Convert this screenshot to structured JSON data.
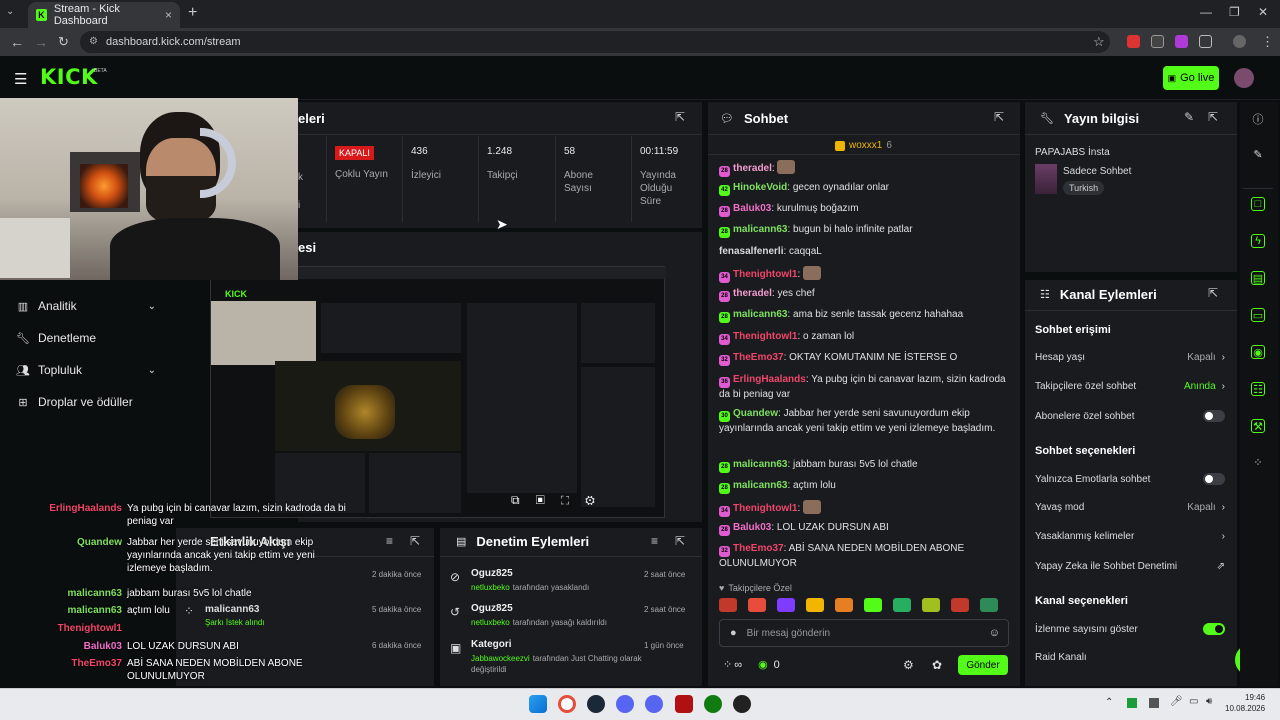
{
  "browser": {
    "tab_title": "Stream - Kick Dashboard",
    "url": "dashboard.kick.com/stream"
  },
  "kick": {
    "logo": "KICK",
    "beta": "BETA",
    "go_live": "Go live"
  },
  "sidebar": {
    "items": [
      {
        "label": "Analitik",
        "icon": "chart-icon"
      },
      {
        "label": "Denetleme",
        "icon": "wrench-icon"
      },
      {
        "label": "Topluluk",
        "icon": "people-icon"
      },
      {
        "label": "Droplar ve ödüller",
        "icon": "gift-icon"
      }
    ]
  },
  "stats_panel": {
    "title_fragment": "eleri",
    "status_badge": "KAPALI",
    "status_label": "Çoklu Yayın",
    "stats": [
      {
        "value": "436",
        "label": "İzleyici"
      },
      {
        "value": "1.248",
        "label": "Takipçi"
      },
      {
        "value": "58",
        "label": "Abone Sayısı"
      },
      {
        "value": "00:11:59",
        "label": "Yayında Olduğu Süre"
      }
    ],
    "cut_left_1": "k",
    "cut_left_2": "i"
  },
  "preview_panel": {
    "title_fragment": "esi"
  },
  "chat": {
    "title": "Sohbet",
    "pinned_user": "woxxx1",
    "pinned_count": "6",
    "messages": [
      {
        "user": "theradel",
        "text": "",
        "color": "#f39ccf",
        "badge": "28"
      },
      {
        "user": "HinokeVoid",
        "text": "gecen oynadılar onlar",
        "color": "#7ee05e",
        "badge": "42"
      },
      {
        "user": "Baluk03",
        "text": "kurulmuş boğazım",
        "color": "#f06fc8",
        "badge": "28"
      },
      {
        "user": "malicann63",
        "text": "bugun bi halo infinite patlar",
        "color": "#7ee05e",
        "badge": "28"
      },
      {
        "user": "fenasalfenerli",
        "text": "caqqaL",
        "color": "#d9d9d9",
        "badge": ""
      },
      {
        "user": "Thenightowl1",
        "text": "",
        "color": "#f0466a",
        "badge": "34"
      },
      {
        "user": "theradel",
        "text": "yes chef",
        "color": "#f39ccf",
        "badge": "28"
      },
      {
        "user": "malicann63",
        "text": "ama biz senle tassak gecenz hahahaa",
        "color": "#7ee05e",
        "badge": "28"
      },
      {
        "user": "Thenightowl1",
        "text": "o zaman lol",
        "color": "#f0466a",
        "badge": "34"
      },
      {
        "user": "TheEmo37",
        "text": "OKTAY KOMUTANIM NE İSTERSE O",
        "color": "#f0466a",
        "badge": "32"
      },
      {
        "user": "ErlingHaalands",
        "text": "Ya pubg için bi canavar lazım, sizin kadroda da bi peniag var",
        "color": "#f0466a",
        "badge": "36"
      },
      {
        "user": "Quandew",
        "text": "Jabbar her yerde seni savunuyordum ekip yayınlarında ancak yeni takip ettim ve yeni izlemeye başladım.",
        "color": "#7ee05e",
        "badge": "30"
      },
      {
        "user": "malicann63",
        "text": "jabbam burası 5v5 lol chatle",
        "color": "#7ee05e",
        "badge": "28"
      },
      {
        "user": "malicann63",
        "text": "açtım lolu",
        "color": "#7ee05e",
        "badge": "28"
      },
      {
        "user": "Thenightowl1",
        "text": "",
        "color": "#f0466a",
        "badge": "34"
      },
      {
        "user": "Baluk03",
        "text": "LOL UZAK DURSUN ABI",
        "color": "#f06fc8",
        "badge": "28"
      },
      {
        "user": "TheEmo37",
        "text": "ABİ SANA NEDEN MOBİLDEN ABONE OLUNULMUYOR",
        "color": "#f0466a",
        "badge": "32"
      }
    ],
    "followers_only": "Takipçilere Özel",
    "input_placeholder": "Bir mesaj gönderin",
    "points_count": "0",
    "send_button": "Gönder"
  },
  "stream_info": {
    "title": "Yayın bilgisi",
    "stream_title": "PAPAJABS İnsta",
    "category": "Sadece Sohbet",
    "tag": "Turkish"
  },
  "channel_actions": {
    "title": "Kanal Eylemleri",
    "chat_access": "Sohbet erişimi",
    "account_age": {
      "label": "Hesap yaşı",
      "value": "Kapalı"
    },
    "followers_chat": {
      "label": "Takipçilere özel sohbet",
      "value": "Anında"
    },
    "subs_chat": {
      "label": "Abonelere özel sohbet",
      "on": false
    },
    "chat_options": "Sohbet seçenekleri",
    "emotes_only": {
      "label": "Yalnızca Emotlarla sohbet",
      "on": false
    },
    "slow_mode": {
      "label": "Yavaş mod",
      "value": "Kapalı"
    },
    "banned_words": {
      "label": "Yasaklanmış kelimeler"
    },
    "ai_moderation": {
      "label": "Yapay Zeka ile Sohbet Denetimi"
    },
    "channel_options": "Kanal seçenekleri",
    "show_viewers": {
      "label": "İzlenme sayısını göster",
      "on": true
    },
    "raid": {
      "label": "Raid Kanalı"
    }
  },
  "activity_feed": {
    "title": "Etkinlik Akışı",
    "items": [
      {
        "user": "",
        "sub": "",
        "time": "2 dakika önce"
      },
      {
        "user": "malicann63",
        "sub": "Şarkı İstek alındı",
        "time": "5 dakika önce"
      },
      {
        "user": "",
        "sub": "",
        "time": "6 dakika önce"
      }
    ]
  },
  "mod_actions": {
    "title": "Denetim Eylemleri",
    "items": [
      {
        "user": "Oguz825",
        "sub_user": "netluxbeko",
        "sub": "tarafından yasaklandı",
        "time": "2 saat önce",
        "icon": "ban-icon"
      },
      {
        "user": "Oguz825",
        "sub_user": "netluxbeko",
        "sub": "tarafından yasağı kaldırıldı",
        "time": "2 saat önce",
        "icon": "undo-icon"
      },
      {
        "user": "Kategori",
        "sub_user": "Jabbawockeezvi",
        "sub": "tarafından Just Chatting olarak değiştirildi",
        "time": "1 gün önce",
        "icon": "category-icon"
      }
    ]
  },
  "overlay_chat": [
    {
      "user": "ErlingHaalands",
      "text": "Ya pubg için bi canavar lazım, sizin kadroda da bi peniag var",
      "color": "#f0466a"
    },
    {
      "user": "Quandew",
      "text": "Jabbar her yerde seni savunuyordum ekip yayınlarında ancak yeni takip ettim ve yeni izlemeye başladım.",
      "color": "#7ee05e"
    },
    {
      "user": "malicann63",
      "text": "jabbam burası 5v5 lol chatle",
      "color": "#7ee05e"
    },
    {
      "user": "malicann63",
      "text": "açtım lolu",
      "color": "#7ee05e"
    },
    {
      "user": "Thenightowl1",
      "text": "",
      "color": "#f0466a"
    },
    {
      "user": "Baluk03",
      "text": "LOL UZAK DURSUN ABI",
      "color": "#f06fc8"
    },
    {
      "user": "TheEmo37",
      "text": "ABİ SANA NEDEN MOBİLDEN ABONE OLUNULMUYOR",
      "color": "#f0466a"
    }
  ],
  "taskbar": {
    "time": "19:46",
    "date": "10.08.2026"
  },
  "colors": {
    "accent": "#53fc18",
    "danger": "#d7191a",
    "panel": "#191b1f"
  }
}
